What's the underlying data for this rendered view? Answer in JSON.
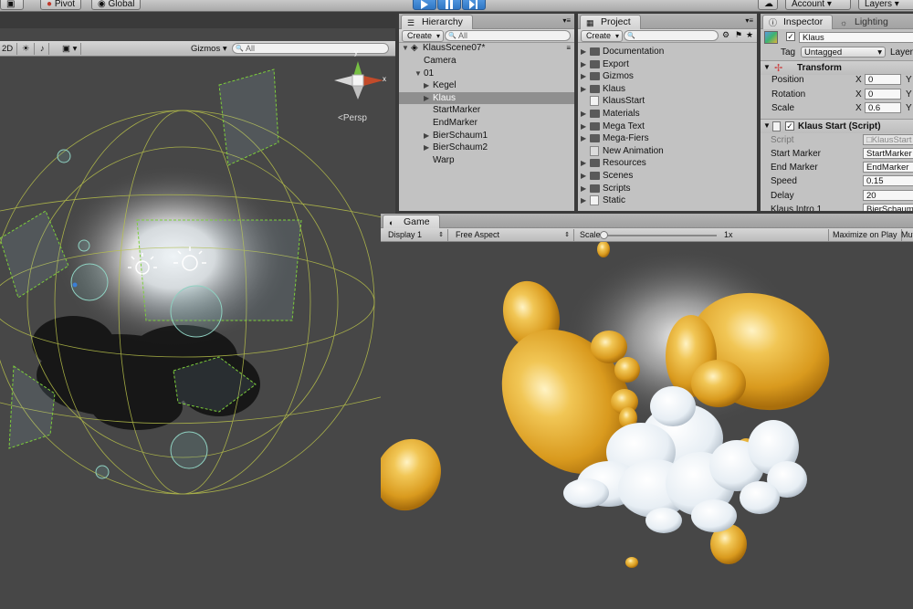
{
  "toolbar": {
    "pivot_label": "Pivot",
    "global_label": "Global",
    "account_label": "Account",
    "layers_label": "Layers"
  },
  "scene": {
    "mode_2d": "2D",
    "gizmos_label": "Gizmos",
    "search_placeholder": "All",
    "persp_label": "Persp",
    "axis_y": "y",
    "axis_x": "x"
  },
  "hierarchy": {
    "tab_label": "Hierarchy",
    "create_label": "Create",
    "search_placeholder": "All",
    "scene_name": "KlausScene07*",
    "items": [
      {
        "label": "Camera",
        "indent": 0,
        "arrow": ""
      },
      {
        "label": "01",
        "indent": 0,
        "arrow": "▼"
      },
      {
        "label": "Kegel",
        "indent": 1,
        "arrow": "▶"
      },
      {
        "label": "Klaus",
        "indent": 1,
        "arrow": "▶",
        "selected": true
      },
      {
        "label": "StartMarker",
        "indent": 1,
        "arrow": ""
      },
      {
        "label": "EndMarker",
        "indent": 1,
        "arrow": ""
      },
      {
        "label": "BierSchaum1",
        "indent": 1,
        "arrow": "▶"
      },
      {
        "label": "BierSchaum2",
        "indent": 1,
        "arrow": "▶"
      },
      {
        "label": "Warp",
        "indent": 1,
        "arrow": ""
      }
    ]
  },
  "project": {
    "tab_label": "Project",
    "create_label": "Create",
    "items": [
      {
        "label": "Documentation",
        "kind": "folder"
      },
      {
        "label": "Export",
        "kind": "folder"
      },
      {
        "label": "Gizmos",
        "kind": "folder"
      },
      {
        "label": "Klaus",
        "kind": "folder"
      },
      {
        "label": "KlausStart",
        "kind": "script"
      },
      {
        "label": "Materials",
        "kind": "folder"
      },
      {
        "label": "Mega Text",
        "kind": "folder"
      },
      {
        "label": "Mega-Fiers",
        "kind": "folder"
      },
      {
        "label": "New Animation",
        "kind": "anim"
      },
      {
        "label": "Resources",
        "kind": "folder"
      },
      {
        "label": "Scenes",
        "kind": "folder"
      },
      {
        "label": "Scripts",
        "kind": "folder"
      },
      {
        "label": "Static",
        "kind": "static"
      }
    ]
  },
  "inspector": {
    "tab_label": "Inspector",
    "lighting_label": "Lighting",
    "object_name": "Klaus",
    "tag_label": "Tag",
    "tag_value": "Untagged",
    "layer_label": "Layer",
    "transform_title": "Transform",
    "transform": [
      {
        "label": "Position",
        "x": "0",
        "y": "Y"
      },
      {
        "label": "Rotation",
        "x": "0",
        "y": "Y"
      },
      {
        "label": "Scale",
        "x": "0.6",
        "y": "Y"
      }
    ],
    "axis_x": "X",
    "script_title": "Klaus Start (Script)",
    "script_label": "Script",
    "script_value": "KlausStart",
    "fields": [
      {
        "label": "Start Marker",
        "value": "StartMarker"
      },
      {
        "label": "End Marker",
        "value": "EndMarker"
      },
      {
        "label": "Speed",
        "value": "0.15"
      },
      {
        "label": "Delay",
        "value": "20"
      },
      {
        "label": "Klaus Intro 1",
        "value": "BierSchaum"
      }
    ]
  },
  "game": {
    "tab_label": "Game",
    "display_label": "Display 1",
    "aspect_label": "Free Aspect",
    "scale_label": "Scale",
    "scale_value": "1x",
    "maximize_label": "Maximize on Play",
    "mute_label": "Mute"
  }
}
